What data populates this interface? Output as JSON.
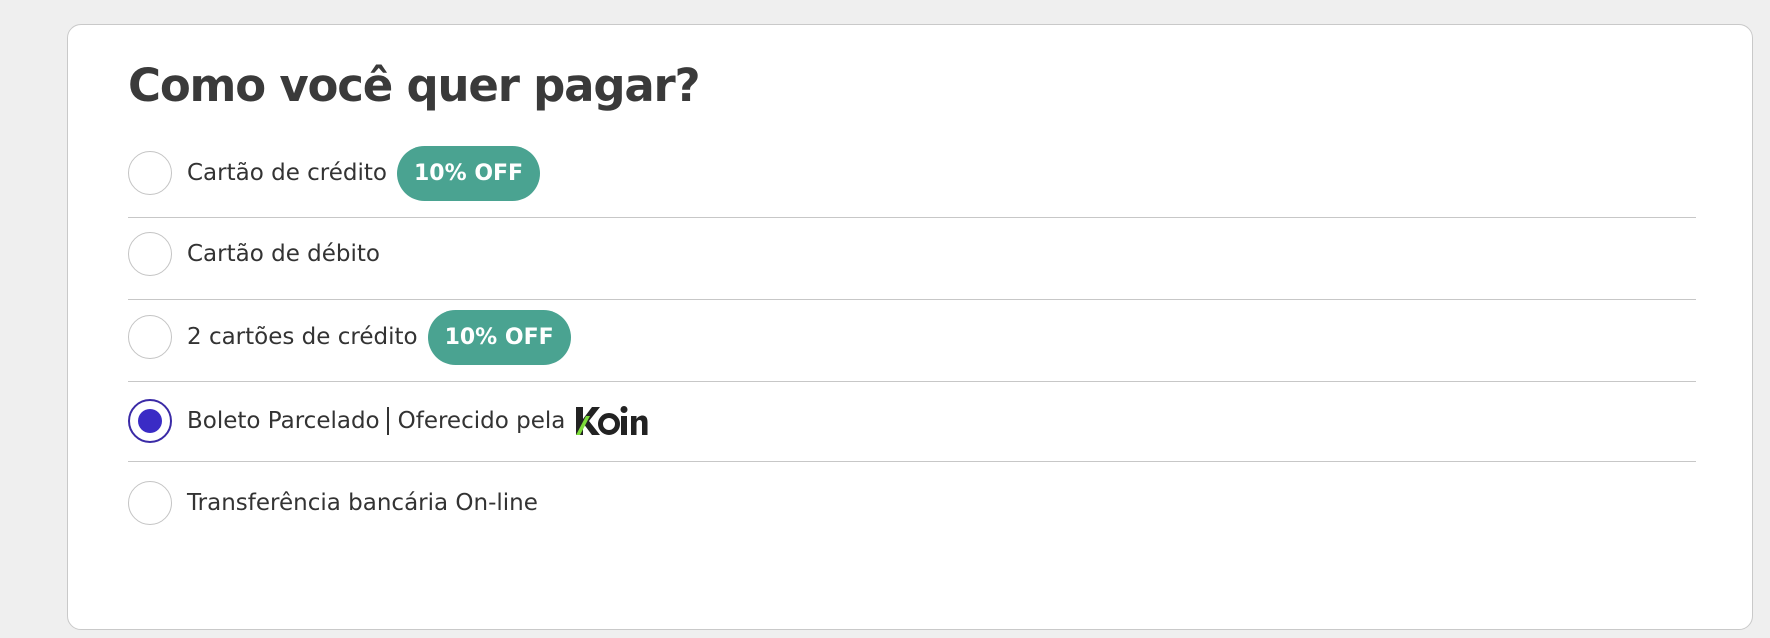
{
  "title": "Como você quer pagar?",
  "payment_options": [
    {
      "label": "Cartão de crédito",
      "badge": "10% OFF",
      "selected": false
    },
    {
      "label": "Cartão de débito",
      "selected": false
    },
    {
      "label": "2 cartões de crédito",
      "badge": "10% OFF",
      "selected": false
    },
    {
      "label": "Boleto Parcelado",
      "sublabel": "Oferecido pela",
      "logo": "Koin",
      "selected": true
    },
    {
      "label": "Transferência bancária On-line",
      "selected": false
    }
  ],
  "colors": {
    "badge_bg": "#4aa391",
    "radio_selected": "#3a2bc5",
    "koin_accent": "#7ddc3a"
  }
}
